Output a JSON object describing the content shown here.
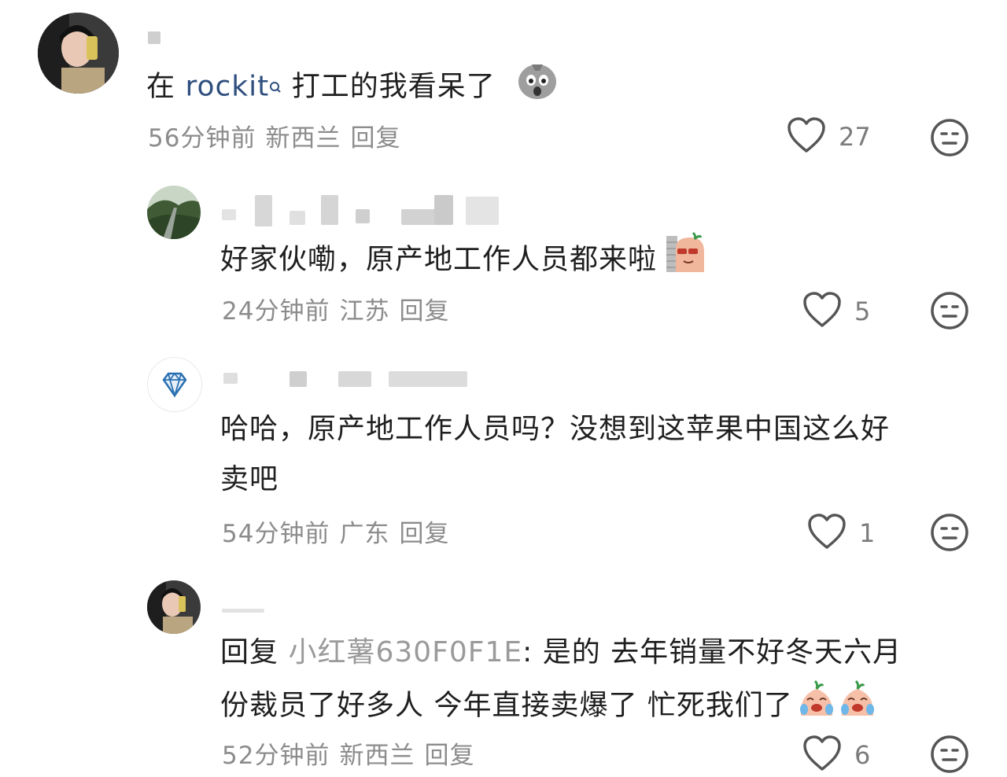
{
  "comments": [
    {
      "text_prefix": "在 ",
      "mention": "rockit",
      "text_suffix": " 打工的我看呆了",
      "time": "56分钟前",
      "location": "新西兰",
      "reply_label": "回复",
      "likes": "27",
      "emoji": "shocked-face"
    },
    {
      "text": "好家伙嘞，原产地工作人员都来啦",
      "time": "24分钟前",
      "location": "江苏",
      "reply_label": "回复",
      "likes": "5",
      "emoji": "peeking-face"
    },
    {
      "text_line1": "哈哈，原产地工作人员吗？没想到这苹果中国这么好",
      "text_line2": "卖吧",
      "time": "54分钟前",
      "location": "广东",
      "reply_label": "回复",
      "likes": "1"
    },
    {
      "reply_prefix": "回复 ",
      "reply_target": "小红薯630F0F1E",
      "text_line1_rest": ": 是的 去年销量不好冬天六月",
      "text_line2": "份裁员了好多人 今年直接卖爆了 忙死我们了",
      "time": "52分钟前",
      "location": "新西兰",
      "reply_label": "回复",
      "likes": "6",
      "emoji": "crying-face"
    }
  ]
}
